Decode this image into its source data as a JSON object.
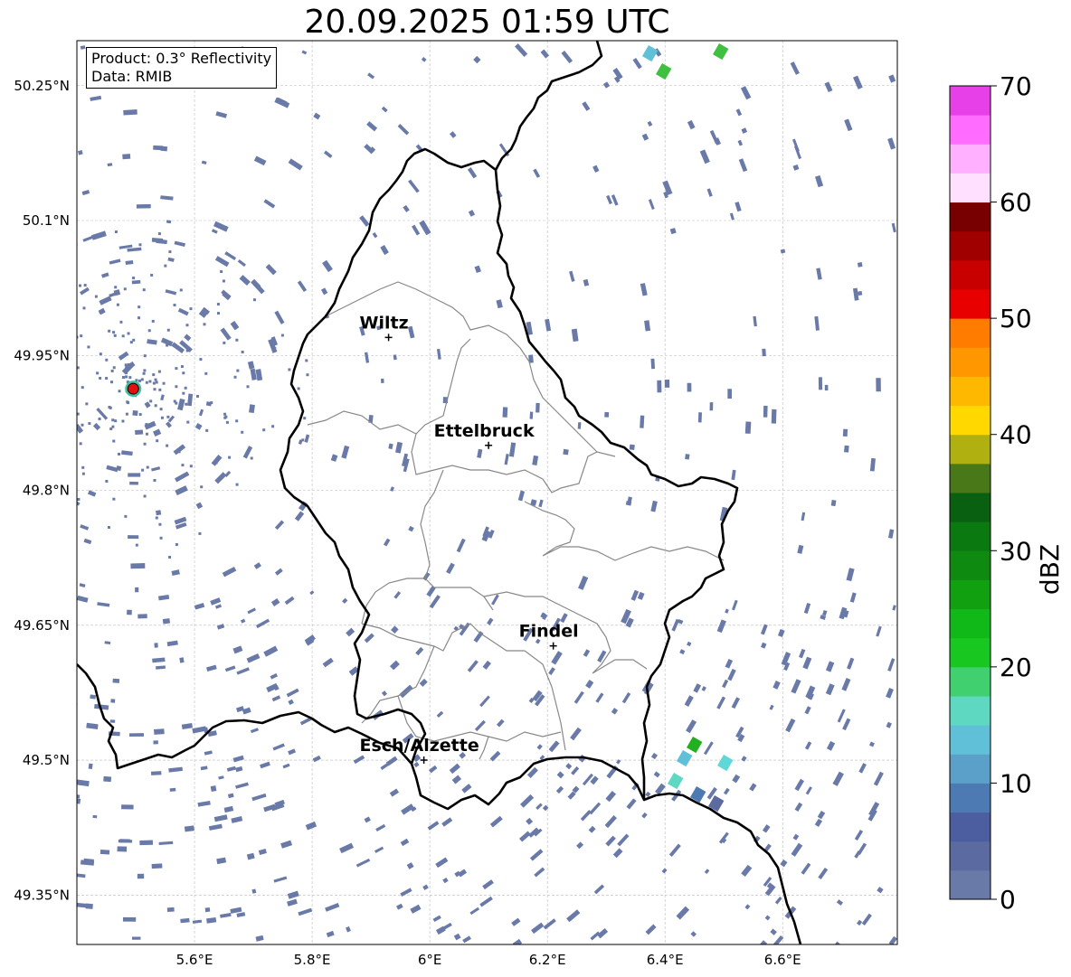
{
  "title": "20.09.2025 01:59 UTC",
  "info_box": {
    "product": "Product: 0.3° Reflectivity",
    "data": "Data: RMIB"
  },
  "map": {
    "lon_range": [
      5.4,
      6.795
    ],
    "lat_range": [
      49.295,
      50.3
    ],
    "x_ticks": [
      {
        "value": 5.6,
        "label": "5.6°E"
      },
      {
        "value": 5.8,
        "label": "5.8°E"
      },
      {
        "value": 6.0,
        "label": "6°E"
      },
      {
        "value": 6.2,
        "label": "6.2°E"
      },
      {
        "value": 6.4,
        "label": "6.4°E"
      },
      {
        "value": 6.6,
        "label": "6.6°E"
      }
    ],
    "y_ticks": [
      {
        "value": 50.25,
        "label": "50.25°N"
      },
      {
        "value": 50.1,
        "label": "50.1°N"
      },
      {
        "value": 49.95,
        "label": "49.95°N"
      },
      {
        "value": 49.8,
        "label": "49.8°N"
      },
      {
        "value": 49.65,
        "label": "49.65°N"
      },
      {
        "value": 49.5,
        "label": "49.5°N"
      },
      {
        "value": 49.35,
        "label": "49.35°N"
      }
    ],
    "cities": [
      {
        "name": "Wiltz",
        "lon": 5.93,
        "lat": 49.97
      },
      {
        "name": "Ettelbruck",
        "lon": 6.1,
        "lat": 49.85
      },
      {
        "name": "Findel",
        "lon": 6.21,
        "lat": 49.627
      },
      {
        "name": "Esch/Alzette",
        "lon": 5.99,
        "lat": 49.5
      }
    ],
    "radar_site": {
      "lon": 5.505,
      "lat": 49.915
    }
  },
  "colorbar": {
    "label": "dBZ",
    "min": 0,
    "max": 70,
    "ticks": [
      "0",
      "10",
      "20",
      "30",
      "40",
      "50",
      "60",
      "70"
    ],
    "colors": [
      "#6a7aa8",
      "#5b6aa0",
      "#4c5ea0",
      "#4d7ab2",
      "#5aa0c8",
      "#60c0d8",
      "#5ed8c0",
      "#40d070",
      "#18c820",
      "#10b818",
      "#10a010",
      "#0e8a10",
      "#0a7a10",
      "#086010",
      "#487818",
      "#b0b010",
      "#ffd800",
      "#ffb800",
      "#ff9800",
      "#ff7c00",
      "#e80000",
      "#c80000",
      "#a00000",
      "#780000",
      "#ffe0ff",
      "#ffb0ff",
      "#ff6cff",
      "#e840e8"
    ]
  }
}
